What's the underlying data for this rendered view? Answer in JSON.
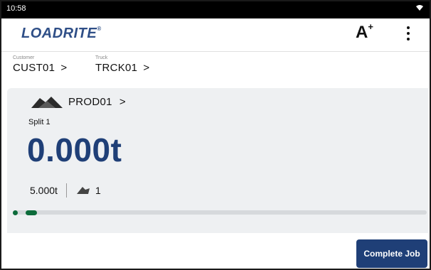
{
  "status": {
    "time": "10:58",
    "wifi_icon": "wifi-icon"
  },
  "header": {
    "logo": "LOADRITE",
    "logo_tm": "®",
    "font_size_label": "A",
    "font_size_plus": "+"
  },
  "crumbs": {
    "customer": {
      "caption": "Customer",
      "value": "CUST01"
    },
    "truck": {
      "caption": "Truck",
      "value": "TRCK01"
    },
    "chevron": ">"
  },
  "card": {
    "product": "PROD01",
    "chevron": ">",
    "split": "Split 1",
    "weight": "0.000t",
    "target": "5.000t",
    "bucket_count": "1"
  },
  "progress": {
    "steps_completed": 2
  },
  "actions": {
    "complete_job": "Complete Job"
  },
  "colors": {
    "brand": "#1f3f77",
    "dot": "#0c6b3a",
    "card_bg": "#eef0f2"
  }
}
